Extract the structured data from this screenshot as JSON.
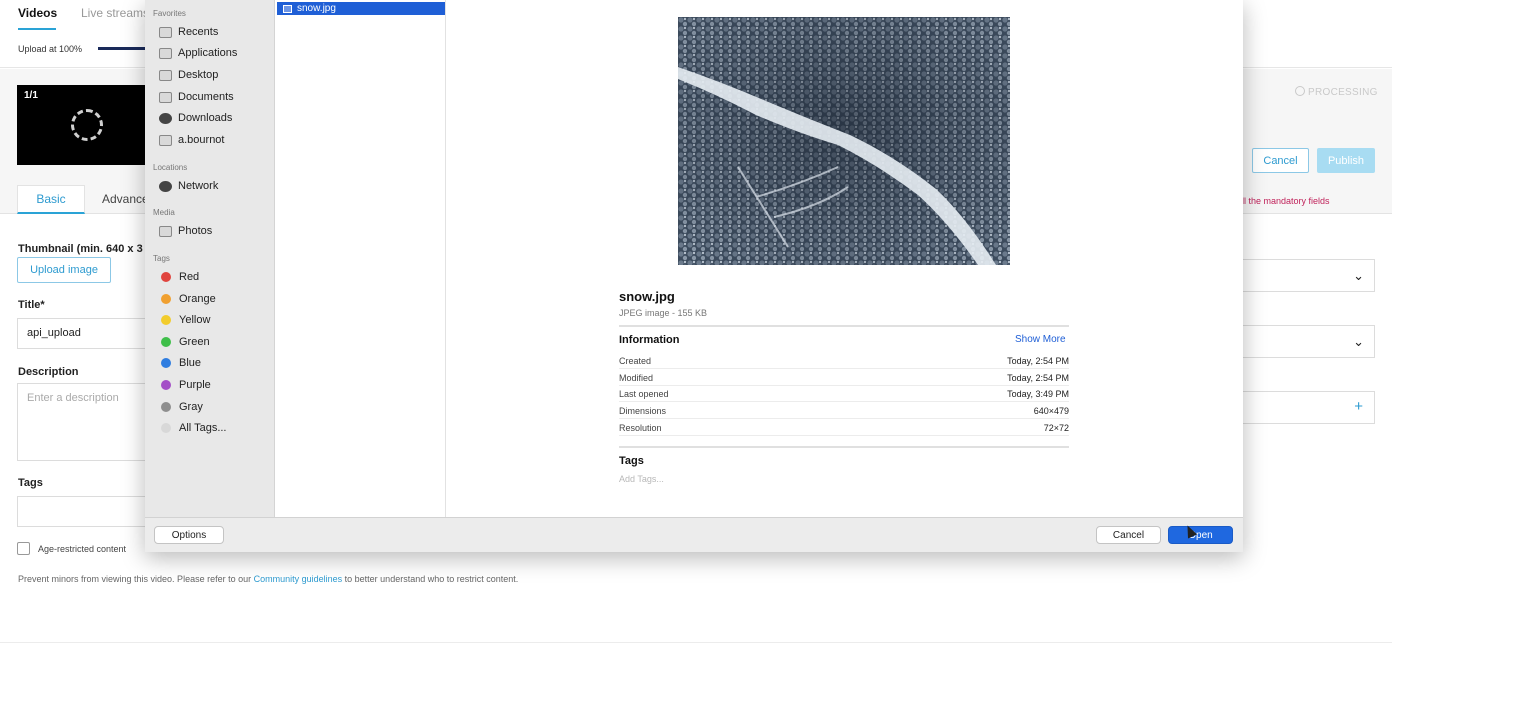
{
  "app": {
    "top_tabs": [
      {
        "label": "Videos"
      },
      {
        "label": "Live streams"
      }
    ],
    "upload_status": "Upload at 100%",
    "upload_progress": 1.0,
    "thumb_count": "1/1",
    "processing_label": "PROCESSING",
    "cancel_label": "Cancel",
    "publish_label": "Publish",
    "mandatory_note": "ll the mandatory fields",
    "form_tabs": [
      {
        "label": "Basic"
      },
      {
        "label": "Advance"
      }
    ],
    "thumbnail_label": "Thumbnail (min. 640 x 3",
    "upload_image_label": "Upload image",
    "title_label": "Title",
    "title_required_mark": "*",
    "title_value": "api_upload",
    "description_label": "Description",
    "description_placeholder": "Enter a description",
    "tags_label": "Tags",
    "age_restricted_label": "Age-restricted content",
    "help_text_before": "Prevent minors from viewing this video. Please refer to our ",
    "help_link": "Community guidelines",
    "help_text_after": " to better understand who to restrict content."
  },
  "dialog": {
    "sidebar": {
      "favorites_label": "Favorites",
      "favorites": [
        {
          "label": "Recents",
          "icon": "clock-icon"
        },
        {
          "label": "Applications",
          "icon": "applications-icon"
        },
        {
          "label": "Desktop",
          "icon": "desktop-icon"
        },
        {
          "label": "Documents",
          "icon": "documents-icon"
        },
        {
          "label": "Downloads",
          "icon": "download-icon"
        },
        {
          "label": "a.bournot",
          "icon": "home-folder-icon"
        }
      ],
      "locations_label": "Locations",
      "locations": [
        {
          "label": "Network",
          "icon": "network-icon"
        }
      ],
      "media_label": "Media",
      "media": [
        {
          "label": "Photos",
          "icon": "camera-icon"
        }
      ],
      "tags_label": "Tags",
      "tags": [
        {
          "label": "Red",
          "color": "#e0443e"
        },
        {
          "label": "Orange",
          "color": "#f0a030"
        },
        {
          "label": "Yellow",
          "color": "#f2cc2c"
        },
        {
          "label": "Green",
          "color": "#3fbf4a"
        },
        {
          "label": "Blue",
          "color": "#2f7de0"
        },
        {
          "label": "Purple",
          "color": "#a44fc7"
        },
        {
          "label": "Gray",
          "color": "#8e8e8e"
        },
        {
          "label": "All Tags...",
          "color": "#d8d8d8"
        }
      ]
    },
    "selected_file": "snow.jpg",
    "preview": {
      "name": "snow.jpg",
      "kind": "JPEG image - 155 KB",
      "information_label": "Information",
      "show_more": "Show More",
      "info": [
        {
          "key": "Created",
          "value": "Today, 2:54 PM"
        },
        {
          "key": "Modified",
          "value": "Today, 2:54 PM"
        },
        {
          "key": "Last opened",
          "value": "Today, 3:49 PM"
        },
        {
          "key": "Dimensions",
          "value": "640×479"
        },
        {
          "key": "Resolution",
          "value": "72×72"
        }
      ],
      "tags_label": "Tags",
      "add_tags": "Add Tags..."
    },
    "options_label": "Options",
    "cancel_label": "Cancel",
    "open_label": "Open"
  }
}
